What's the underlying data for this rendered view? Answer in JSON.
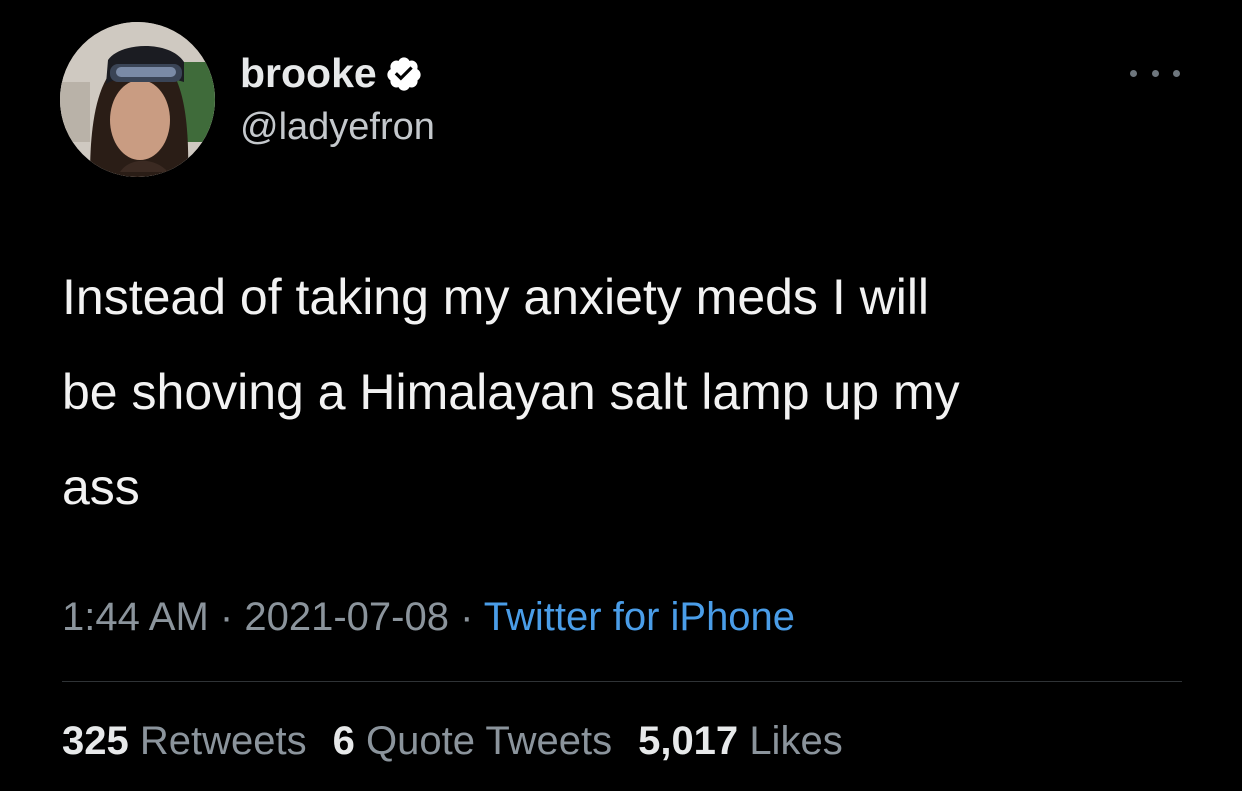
{
  "author": {
    "display_name": "brooke",
    "handle": "@ladyefron",
    "verified_icon": "verified-badge-icon",
    "avatar_icon": "profile-photo"
  },
  "tweet": {
    "lines": [
      "Instead of taking my anxiety meds I will",
      "be shoving a Himalayan salt lamp up my",
      "ass"
    ]
  },
  "meta": {
    "time": "1:44 AM",
    "separator": "·",
    "date": "2021-07-08",
    "source": "Twitter for iPhone"
  },
  "stats": {
    "retweets_count": "325",
    "retweets_label": "Retweets",
    "quotes_count": "6",
    "quotes_label": "Quote Tweets",
    "likes_count": "5,017",
    "likes_label": "Likes"
  },
  "colors": {
    "background": "#000000",
    "text": "#e7e9ea",
    "secondary": "#8b949c",
    "link": "#4a9de8",
    "divider": "#2f3336"
  }
}
